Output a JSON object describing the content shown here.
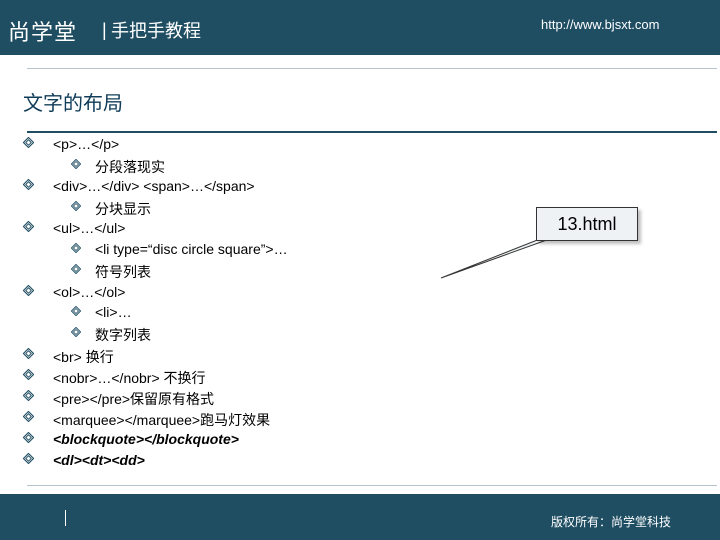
{
  "header": {
    "logo": "尚学堂",
    "separator": "|",
    "subtitle": "手把手教程",
    "url": "http://www.bjsxt.com"
  },
  "slide": {
    "title": "文字的布局",
    "bullets": [
      {
        "level": 1,
        "text": "<p>…</p>"
      },
      {
        "level": 2,
        "text": "分段落现实"
      },
      {
        "level": 1,
        "text": "<div>…</div> <span>…</span>"
      },
      {
        "level": 2,
        "text": "分块显示"
      },
      {
        "level": 1,
        "text": "<ul>…</ul>"
      },
      {
        "level": 2,
        "text": "<li type=“disc circle square”>…"
      },
      {
        "level": 2,
        "text": "符号列表"
      },
      {
        "level": 1,
        "text": "<ol>…</ol>"
      },
      {
        "level": 2,
        "text": "<li>…"
      },
      {
        "level": 2,
        "text": "数字列表"
      },
      {
        "level": 1,
        "text": "<br>  换行"
      },
      {
        "level": 1,
        "text": "<nobr>…</nobr>  不换行"
      },
      {
        "level": 1,
        "text": "<pre></pre>保留原有格式"
      },
      {
        "level": 1,
        "text": "<marquee></marquee>跑马灯效果"
      },
      {
        "level": 1,
        "text": "<blockquote></blockquote>",
        "bold": true
      },
      {
        "level": 1,
        "text": "<dl><dt><dd>",
        "bold": true
      }
    ],
    "callout": "13.html"
  },
  "footer": {
    "copyright": "版权所有：尚学堂科技"
  },
  "colors": {
    "header_bg": "#1f4e63",
    "title_text": "#103c58",
    "bullet_icon": "#1f4e63"
  }
}
